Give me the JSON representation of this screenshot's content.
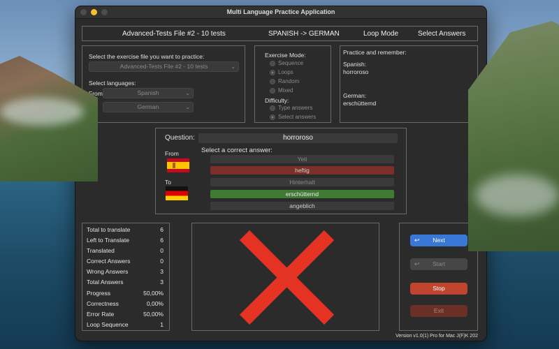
{
  "app": {
    "title": "Multi Language Practice Application",
    "version": "Version v1.0(1) Pro for Mac J(F)K 202"
  },
  "header": {
    "file": "Advanced-Tests File #2 - 10 tests",
    "direction": "SPANISH -> GERMAN",
    "mode": "Loop Mode",
    "difficulty": "Select Answers"
  },
  "exercise": {
    "file_prompt": "Select the exercise file you want to practice:",
    "file_value": "Advanced-Tests File #2 - 10 tests",
    "lang_prompt": "Select languages:",
    "from_label": "From",
    "from_value": "Spanish",
    "to_label": "To",
    "to_value": "German"
  },
  "modes": {
    "mode_title": "Exercise Mode:",
    "options": [
      "Sequence",
      "Loops",
      "Random",
      "Mixed"
    ],
    "selected": "Loops",
    "difficulty_title": "Difficulty:",
    "difficulty_options": [
      "Type answers",
      "Select answers"
    ],
    "difficulty_selected": "Select answers"
  },
  "practice": {
    "title": "Practice and remember:",
    "src_lang": "Spanish:",
    "src_word": "horroroso",
    "dst_lang": "German:",
    "dst_word": "erschütternd"
  },
  "question": {
    "label": "Question:",
    "word": "horroroso",
    "from_label": "From",
    "to_label": "To",
    "select_label": "Select a correct answer:",
    "answers": [
      "Yeti",
      "heftig",
      "Hinterhalt",
      "erschütternd",
      "angeblich"
    ]
  },
  "stats": {
    "rows": [
      {
        "label": "Total to translate",
        "value": "6"
      },
      {
        "label": "Left to Translate",
        "value": "6"
      },
      {
        "label": "Translated",
        "value": "0"
      },
      {
        "label": "Correct Answers",
        "value": "0"
      },
      {
        "label": "Wrong Answers",
        "value": "3"
      },
      {
        "label": "Total Answers",
        "value": "3"
      },
      {
        "label": "Progress",
        "value": "50,00%"
      },
      {
        "label": "Correctness",
        "value": "0,00%"
      },
      {
        "label": "Error Rate",
        "value": "50,00%"
      },
      {
        "label": "Loop Sequence",
        "value": "1"
      }
    ]
  },
  "buttons": {
    "next": "Next",
    "start": "Start",
    "stop": "Stop",
    "exit": "Exit"
  },
  "colors": {
    "next": "#3a78d8",
    "stop": "#c0452f",
    "exit": "#6a3028",
    "correct": "#3f7b35",
    "wrong": "#7a3028",
    "cross": "#e43323"
  }
}
